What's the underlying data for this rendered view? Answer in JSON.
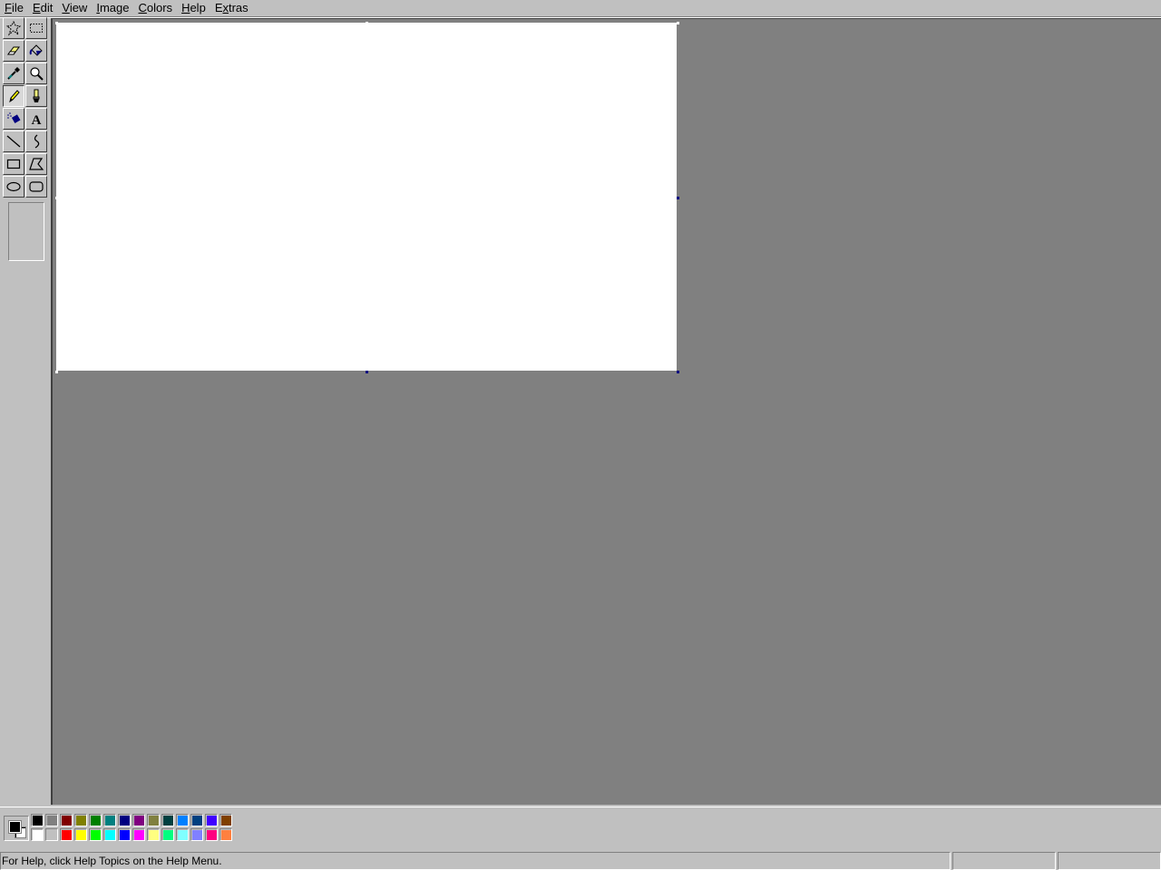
{
  "menubar": {
    "items": [
      {
        "label": "File",
        "access": "F",
        "rest": "ile"
      },
      {
        "label": "Edit",
        "access": "E",
        "rest": "dit"
      },
      {
        "label": "View",
        "access": "V",
        "rest": "iew"
      },
      {
        "label": "Image",
        "access": "I",
        "rest": "mage"
      },
      {
        "label": "Colors",
        "access": "C",
        "rest": "olors"
      },
      {
        "label": "Help",
        "access": "H",
        "rest": "elp"
      },
      {
        "label": "Extras",
        "access": "x",
        "rest_before": "E",
        "rest": "tras"
      }
    ]
  },
  "toolbox": {
    "tools": [
      {
        "name": "free-form-select",
        "icon": "free-form-select-icon"
      },
      {
        "name": "rect-select",
        "icon": "rect-select-icon"
      },
      {
        "name": "eraser",
        "icon": "eraser-icon"
      },
      {
        "name": "fill",
        "icon": "fill-bucket-icon"
      },
      {
        "name": "pick-color",
        "icon": "eyedropper-icon"
      },
      {
        "name": "magnifier",
        "icon": "magnifier-icon"
      },
      {
        "name": "pencil",
        "icon": "pencil-icon",
        "active": true
      },
      {
        "name": "brush",
        "icon": "brush-icon"
      },
      {
        "name": "airbrush",
        "icon": "airbrush-icon"
      },
      {
        "name": "text",
        "icon": "text-icon"
      },
      {
        "name": "line",
        "icon": "line-icon"
      },
      {
        "name": "curve",
        "icon": "curve-icon"
      },
      {
        "name": "rectangle",
        "icon": "rectangle-icon"
      },
      {
        "name": "polygon",
        "icon": "polygon-icon"
      },
      {
        "name": "ellipse",
        "icon": "ellipse-icon"
      },
      {
        "name": "rounded-rectangle",
        "icon": "rounded-rectangle-icon"
      }
    ]
  },
  "colors": {
    "foreground": "#000000",
    "background": "#ffffff",
    "palette_top": [
      "#000000",
      "#808080",
      "#800000",
      "#808000",
      "#008000",
      "#008080",
      "#000080",
      "#800080",
      "#808040",
      "#004040",
      "#0080ff",
      "#004080",
      "#4000ff",
      "#804000"
    ],
    "palette_bottom": [
      "#ffffff",
      "#c0c0c0",
      "#ff0000",
      "#ffff00",
      "#00ff00",
      "#00ffff",
      "#0000ff",
      "#ff00ff",
      "#ffff80",
      "#00ff80",
      "#80ffff",
      "#8080ff",
      "#ff0080",
      "#ff8040"
    ]
  },
  "statusbar": {
    "help_text": "For Help, click Help Topics on the Help Menu.",
    "coords": "",
    "size": ""
  }
}
